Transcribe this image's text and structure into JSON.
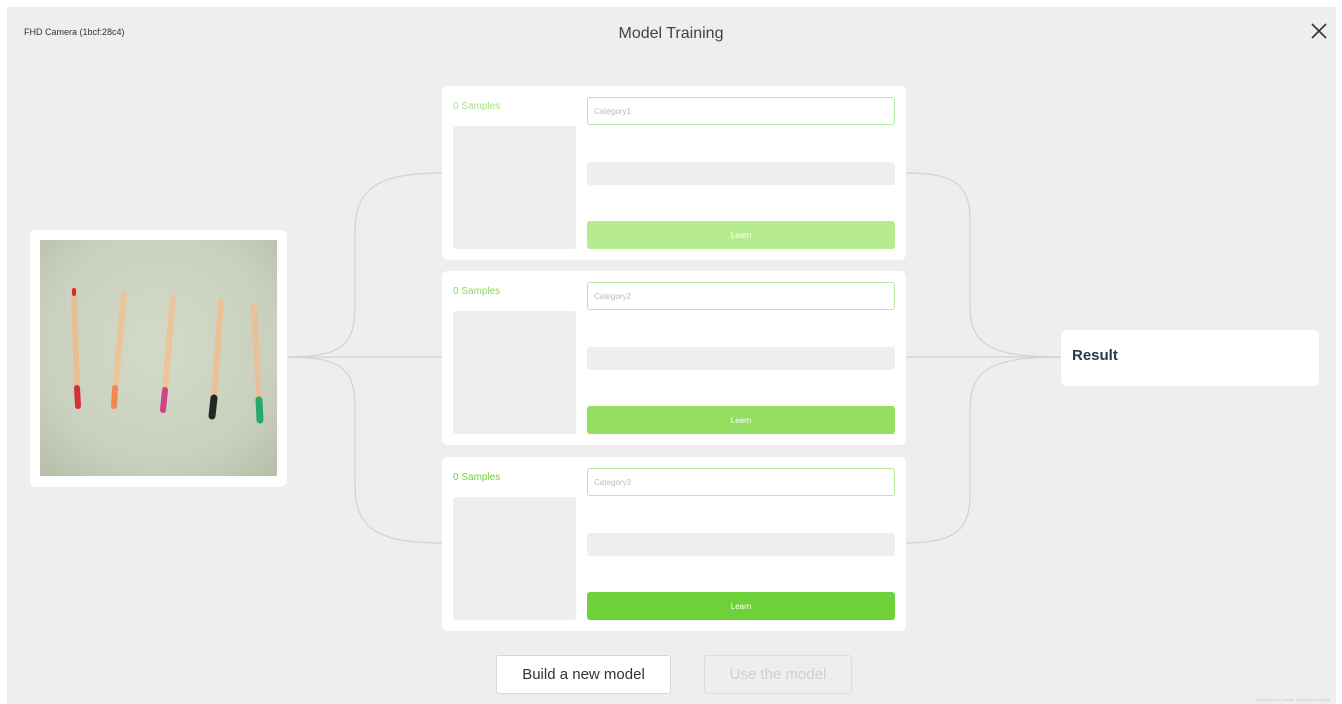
{
  "header": {
    "camera_name": "FHD Camera (1bcf:28c4)",
    "title": "Model Training",
    "close_icon": "close-icon"
  },
  "classes": [
    {
      "samples_label": "0 Samples",
      "placeholder": "Category1",
      "learn_label": "Learn",
      "accent": "#b6ec8f",
      "samples_color": "#a9df86"
    },
    {
      "samples_label": "0 Samples",
      "placeholder": "Category2",
      "learn_label": "Learn",
      "accent": "#94de62",
      "samples_color": "#8ad85a"
    },
    {
      "samples_label": "0 Samples",
      "placeholder": "Category3",
      "learn_label": "Learn",
      "accent": "#6fd13a",
      "samples_color": "#6fcf3b"
    }
  ],
  "result": {
    "label": "Result"
  },
  "actions": {
    "build_label": "Build a new model",
    "use_label": "Use the model"
  },
  "footer": {
    "credit": "Adapted from Google Teachable Machine"
  }
}
